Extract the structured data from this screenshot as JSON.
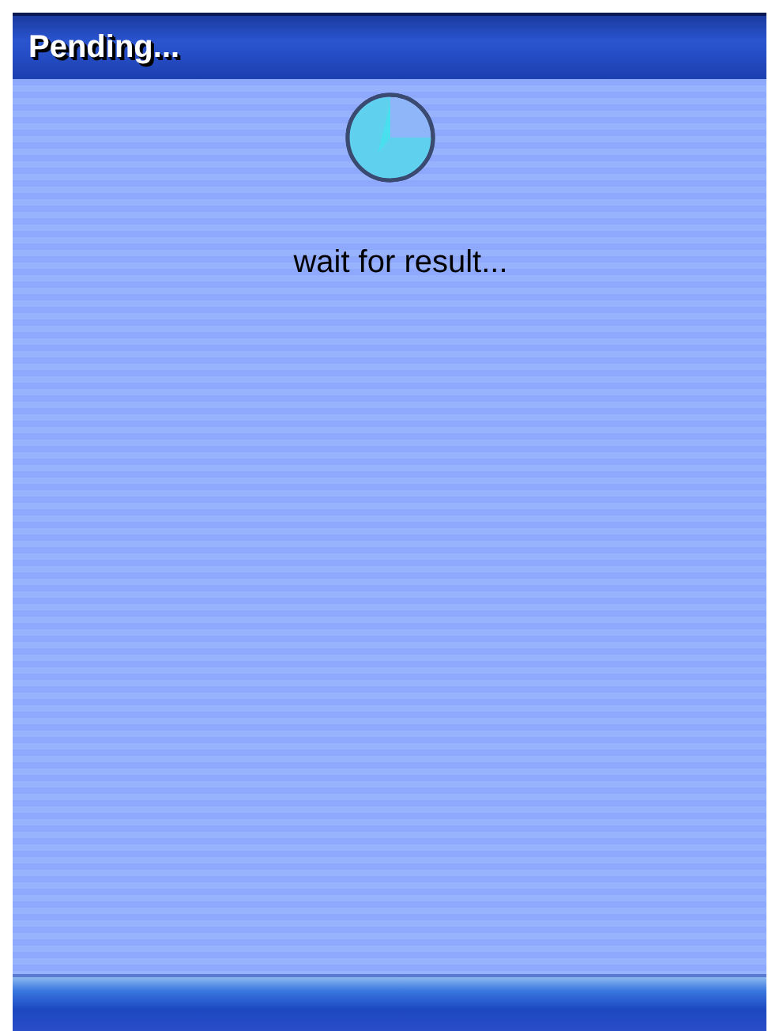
{
  "window": {
    "title": "Pending..."
  },
  "message": "wait for result..."
}
